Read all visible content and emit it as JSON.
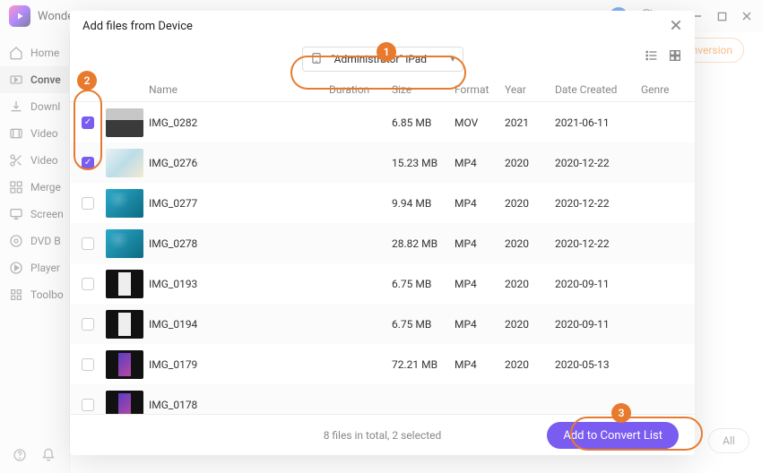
{
  "titlebar": {
    "app_name": "Wonde"
  },
  "sidebar": {
    "items": [
      {
        "label": "Home",
        "icon": "home"
      },
      {
        "label": "Conve",
        "icon": "convert",
        "active": true
      },
      {
        "label": "Downl",
        "icon": "download"
      },
      {
        "label": "Video",
        "icon": "video"
      },
      {
        "label": "Video",
        "icon": "scissors"
      },
      {
        "label": "Merge",
        "icon": "merge"
      },
      {
        "label": "Screen",
        "icon": "screen"
      },
      {
        "label": "DVD B",
        "icon": "dvd"
      },
      {
        "label": "Player",
        "icon": "player"
      },
      {
        "label": "Toolbo",
        "icon": "toolbox"
      }
    ]
  },
  "main_header": {
    "conversion_btn": "onversion"
  },
  "dialog": {
    "title": "Add files from Device",
    "device": "\"Administrator\" iPad",
    "columns": {
      "name": "Name",
      "duration": "Duration",
      "size": "Size",
      "format": "Format",
      "year": "Year",
      "date": "Date Created",
      "genre": "Genre"
    },
    "rows": [
      {
        "checked": true,
        "thumb": "kb",
        "name": "IMG_0282",
        "duration": "",
        "size": "6.85 MB",
        "format": "MOV",
        "year": "2021",
        "date": "2021-06-11",
        "genre": ""
      },
      {
        "checked": true,
        "thumb": "light",
        "name": "IMG_0276",
        "duration": "",
        "size": "15.23 MB",
        "format": "MP4",
        "year": "2020",
        "date": "2020-12-22",
        "genre": ""
      },
      {
        "checked": false,
        "thumb": "wall",
        "name": "IMG_0277",
        "duration": "",
        "size": "9.94 MB",
        "format": "MP4",
        "year": "2020",
        "date": "2020-12-22",
        "genre": ""
      },
      {
        "checked": false,
        "thumb": "wall",
        "name": "IMG_0278",
        "duration": "",
        "size": "28.82 MB",
        "format": "MP4",
        "year": "2020",
        "date": "2020-12-22",
        "genre": ""
      },
      {
        "checked": false,
        "thumb": "port",
        "name": "IMG_0193",
        "duration": "",
        "size": "6.75 MB",
        "format": "MP4",
        "year": "2020",
        "date": "2020-09-11",
        "genre": ""
      },
      {
        "checked": false,
        "thumb": "port",
        "name": "IMG_0194",
        "duration": "",
        "size": "6.75 MB",
        "format": "MP4",
        "year": "2020",
        "date": "2020-09-11",
        "genre": ""
      },
      {
        "checked": false,
        "thumb": "port2",
        "name": "IMG_0179",
        "duration": "",
        "size": "72.21 MB",
        "format": "MP4",
        "year": "2020",
        "date": "2020-05-13",
        "genre": ""
      },
      {
        "checked": false,
        "thumb": "port2",
        "name": "IMG_0178",
        "duration": "",
        "size": "",
        "format": "",
        "year": "",
        "date": "",
        "genre": ""
      }
    ],
    "footer_status": "8 files in total, 2 selected",
    "add_btn": "Add to Convert List"
  },
  "footer": {
    "all_btn": "All"
  },
  "steps": {
    "s1": "1",
    "s2": "2",
    "s3": "3"
  }
}
